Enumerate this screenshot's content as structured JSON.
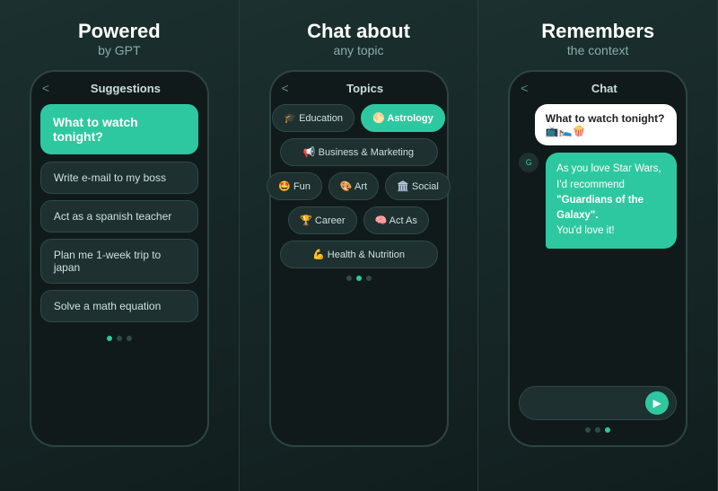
{
  "panel1": {
    "title": "Powered",
    "subtitle": "by GPT",
    "phone_header": "Suggestions",
    "highlight": "What to watch tonight?",
    "items": [
      "Write e-mail to my boss",
      "Act as a spanish teacher",
      "Plan me 1-week trip to japan",
      "Solve a math equation"
    ],
    "dots": [
      true,
      false,
      false
    ]
  },
  "panel2": {
    "title": "Chat about",
    "subtitle": "any topic",
    "phone_header": "Topics",
    "rows": [
      [
        {
          "label": "🎓 Education",
          "active": false
        },
        {
          "label": "🌕 Astrology",
          "active": true
        }
      ],
      [
        {
          "label": "📢 Business & Marketing",
          "active": false,
          "wide": true
        }
      ],
      [
        {
          "label": "🤩 Fun",
          "active": false
        },
        {
          "label": "🎨 Art",
          "active": false
        },
        {
          "label": "🏛️ Social",
          "active": false
        }
      ],
      [
        {
          "label": "🏆 Career",
          "active": false
        },
        {
          "label": "🧠 Act As",
          "active": false
        }
      ],
      [
        {
          "label": "💪 Health & Nutrition",
          "active": false,
          "wide": true
        }
      ]
    ],
    "dots": [
      false,
      true,
      false
    ]
  },
  "panel3": {
    "title": "Remembers",
    "subtitle": "the context",
    "phone_header": "Chat",
    "user_msg": "What to watch tonight? 📺🛌🍿",
    "bot_msg_pre": "As you love Star Wars, I'd recommend ",
    "bot_msg_bold": "\"Guardians of the Galaxy\".",
    "bot_msg_post": "\nYou'd love it!",
    "input_placeholder": "",
    "send_label": "▶",
    "dots": [
      false,
      false,
      true
    ]
  }
}
